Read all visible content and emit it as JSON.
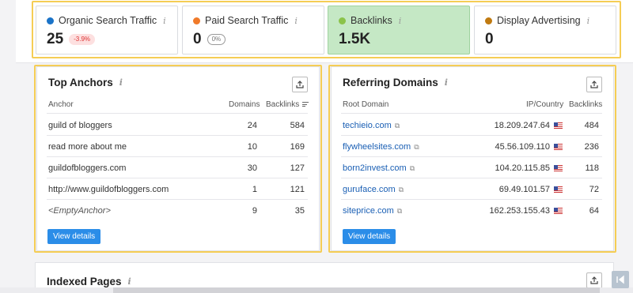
{
  "metrics": [
    {
      "label": "Organic Search Traffic",
      "value": "25",
      "badge": "-3.9%",
      "dot_color": "#1a73c8"
    },
    {
      "label": "Paid Search Traffic",
      "value": "0",
      "badge": "0%",
      "dot_color": "#f07a2a"
    },
    {
      "label": "Backlinks",
      "value": "1.5K",
      "dot_color": "#8bc34a"
    },
    {
      "label": "Display Advertising",
      "value": "0",
      "dot_color": "#c07a10"
    }
  ],
  "info_glyph": "i",
  "top_anchors": {
    "title": "Top Anchors",
    "columns": {
      "anchor": "Anchor",
      "domains": "Domains",
      "backlinks": "Backlinks"
    },
    "rows": [
      {
        "anchor": "guild of bloggers",
        "domains": "24",
        "backlinks": "584"
      },
      {
        "anchor": "read more about me",
        "domains": "10",
        "backlinks": "169"
      },
      {
        "anchor": "guildofbloggers.com",
        "domains": "30",
        "backlinks": "127"
      },
      {
        "anchor": "http://www.guildofbloggers.com",
        "domains": "1",
        "backlinks": "121"
      },
      {
        "anchor": "<EmptyAnchor>",
        "domains": "9",
        "backlinks": "35"
      }
    ],
    "button": "View details"
  },
  "referring_domains": {
    "title": "Referring Domains",
    "columns": {
      "root": "Root Domain",
      "ip": "IP/Country",
      "backlinks": "Backlinks"
    },
    "rows": [
      {
        "domain": "techieio.com",
        "ip": "18.209.247.64",
        "backlinks": "484"
      },
      {
        "domain": "flywheelsites.com",
        "ip": "45.56.109.110",
        "backlinks": "236"
      },
      {
        "domain": "born2invest.com",
        "ip": "104.20.115.85",
        "backlinks": "118"
      },
      {
        "domain": "guruface.com",
        "ip": "69.49.101.57",
        "backlinks": "72"
      },
      {
        "domain": "siteprice.com",
        "ip": "162.253.155.43",
        "backlinks": "64"
      }
    ],
    "button": "View details"
  },
  "indexed_pages": {
    "title": "Indexed Pages"
  },
  "icons": {
    "export": "export-icon",
    "external": "external-link-icon",
    "flag": "us-flag-icon",
    "sort": "sort-icon",
    "collapse": "collapse-icon"
  }
}
